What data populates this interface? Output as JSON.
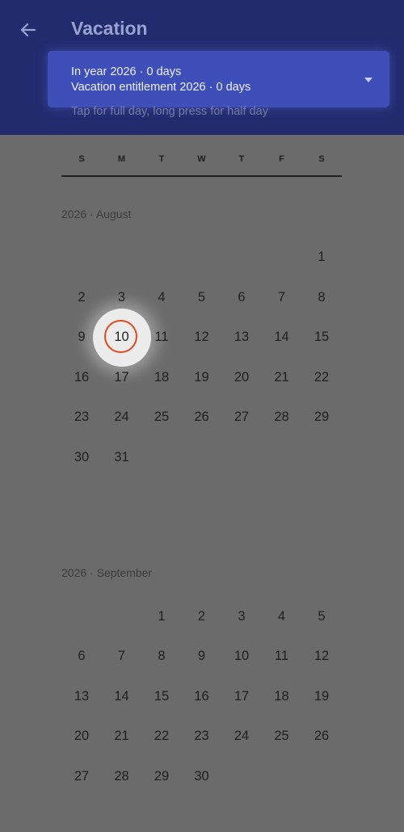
{
  "header": {
    "title": "Vacation",
    "summary_line1": "In year 2026 · 0 days",
    "summary_line2": "Vacation entitlement 2026 · 0 days",
    "hint": "Tap for full day, long press for half day"
  },
  "weekdays": [
    "S",
    "M",
    "T",
    "W",
    "T",
    "F",
    "S"
  ],
  "months": [
    {
      "label": "2026 · August",
      "first_weekday": 6,
      "days": 31
    },
    {
      "label": "2026 · September",
      "first_weekday": 2,
      "days": 30
    }
  ],
  "today": {
    "month_index": 0,
    "day": 10
  },
  "colors": {
    "header_bg": "#222b6e",
    "card_bg": "#3f4fb9",
    "page_bg": "#6b6b6b",
    "today_ring": "#e24a1e"
  },
  "icons": {
    "back": "arrow-left-icon",
    "dropdown": "caret-down-icon"
  }
}
